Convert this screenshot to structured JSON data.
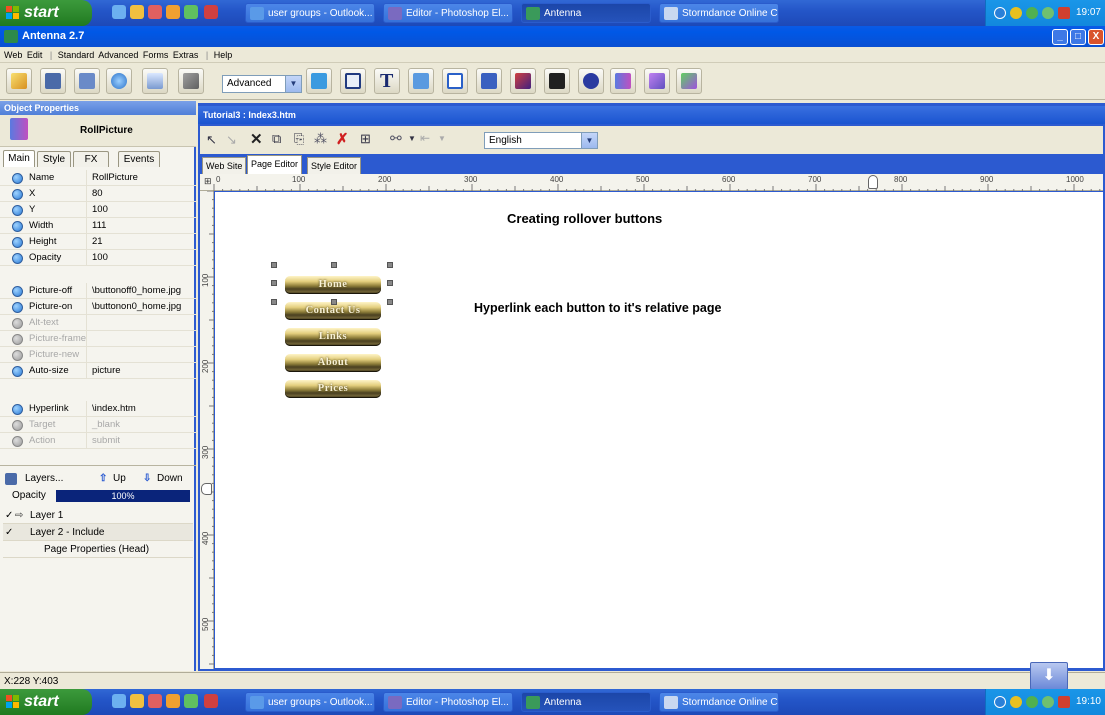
{
  "taskbar_top": {
    "start": "start",
    "tasks": [
      "user groups - Outlook...",
      "Editor - Photoshop El...",
      "Antenna",
      "Stormdance Online C..."
    ],
    "clock": "19:07"
  },
  "taskbar_bottom": {
    "start": "start",
    "tasks": [
      "user groups - Outlook...",
      "Editor - Photoshop El...",
      "Antenna",
      "Stormdance Online C..."
    ],
    "clock": "19:10"
  },
  "window": {
    "title": "Antenna 2.7",
    "minimize": "_",
    "maximize": "□",
    "close": "X"
  },
  "menu": [
    "Web",
    "Edit",
    "Standard",
    "Advanced",
    "Forms",
    "Extras",
    "Help"
  ],
  "toolbar": {
    "mode": "Advanced"
  },
  "object_properties": {
    "header": "Object Properties",
    "object_name": "RollPicture",
    "tabs": [
      "Main",
      "Style",
      "FX",
      "Events"
    ],
    "props": [
      {
        "name": "Name",
        "value": "RollPicture",
        "disabled": false
      },
      {
        "name": "X",
        "value": "80",
        "disabled": false
      },
      {
        "name": "Y",
        "value": "100",
        "disabled": false
      },
      {
        "name": "Width",
        "value": "111",
        "disabled": false
      },
      {
        "name": "Height",
        "value": "21",
        "disabled": false
      },
      {
        "name": "Opacity",
        "value": "100",
        "disabled": false
      }
    ],
    "props2": [
      {
        "name": "Picture-off",
        "value": "\\buttonoff0_home.jpg",
        "disabled": false
      },
      {
        "name": "Picture-on",
        "value": "\\buttonon0_home.jpg",
        "disabled": false
      },
      {
        "name": "Alt-text",
        "value": "",
        "disabled": true
      },
      {
        "name": "Picture-frame",
        "value": "",
        "disabled": true
      },
      {
        "name": "Picture-new",
        "value": "",
        "disabled": true
      },
      {
        "name": "Auto-size",
        "value": "picture",
        "disabled": false
      }
    ],
    "props3": [
      {
        "name": "Hyperlink",
        "value": "\\index.htm",
        "disabled": false
      },
      {
        "name": "Target",
        "value": "_blank",
        "disabled": true
      },
      {
        "name": "Action",
        "value": "submit",
        "disabled": true
      }
    ]
  },
  "layers": {
    "label": "Layers...",
    "up": "Up",
    "down": "Down",
    "opacity_label": "Opacity",
    "opacity_value": "100%",
    "items": [
      "Layer 1",
      "Layer 2 - Include",
      "Page Properties (Head)"
    ]
  },
  "document": {
    "title": "Tutorial3 : Index3.htm",
    "language": "English",
    "tabs": [
      "Web Site",
      "Page Editor",
      "Style Editor"
    ],
    "ruler_h": [
      "0",
      "100",
      "200",
      "300",
      "400",
      "500",
      "600",
      "700",
      "800",
      "900",
      "1000"
    ],
    "ruler_v": [
      "100",
      "200",
      "300",
      "400",
      "500"
    ],
    "heading": "Creating rollover buttons",
    "buttons": [
      "Home",
      "Contact Us",
      "Links",
      "About",
      "Prices"
    ],
    "note": "Hyperlink each button to it's relative page"
  },
  "status": "X:228 Y:403"
}
